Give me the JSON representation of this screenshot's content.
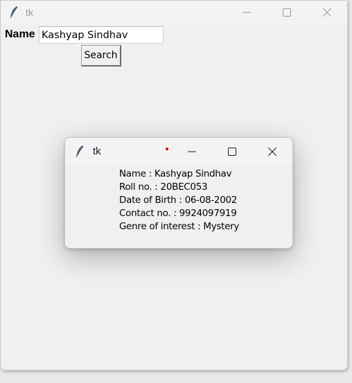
{
  "main_window": {
    "title": "tk",
    "name_label": "Name",
    "name_value": "Kashyap Sindhav",
    "search_label": "Search"
  },
  "popup_window": {
    "title": "tk",
    "lines": [
      "Name : Kashyap Sindhav",
      "Roll no. : 20BEC053",
      "Date of Birth : 06-08-2002",
      "Contact no. : 9924097919",
      "Genre of interest : Mystery"
    ]
  },
  "icons": {
    "app": "tk-feather-icon",
    "minimize": "minimize-icon",
    "maximize": "maximize-icon",
    "close": "close-icon"
  },
  "colors": {
    "window_bg": "#f0f0f0",
    "inactive_title": "#9a9a9a",
    "indicator_dot": "#d40000"
  }
}
